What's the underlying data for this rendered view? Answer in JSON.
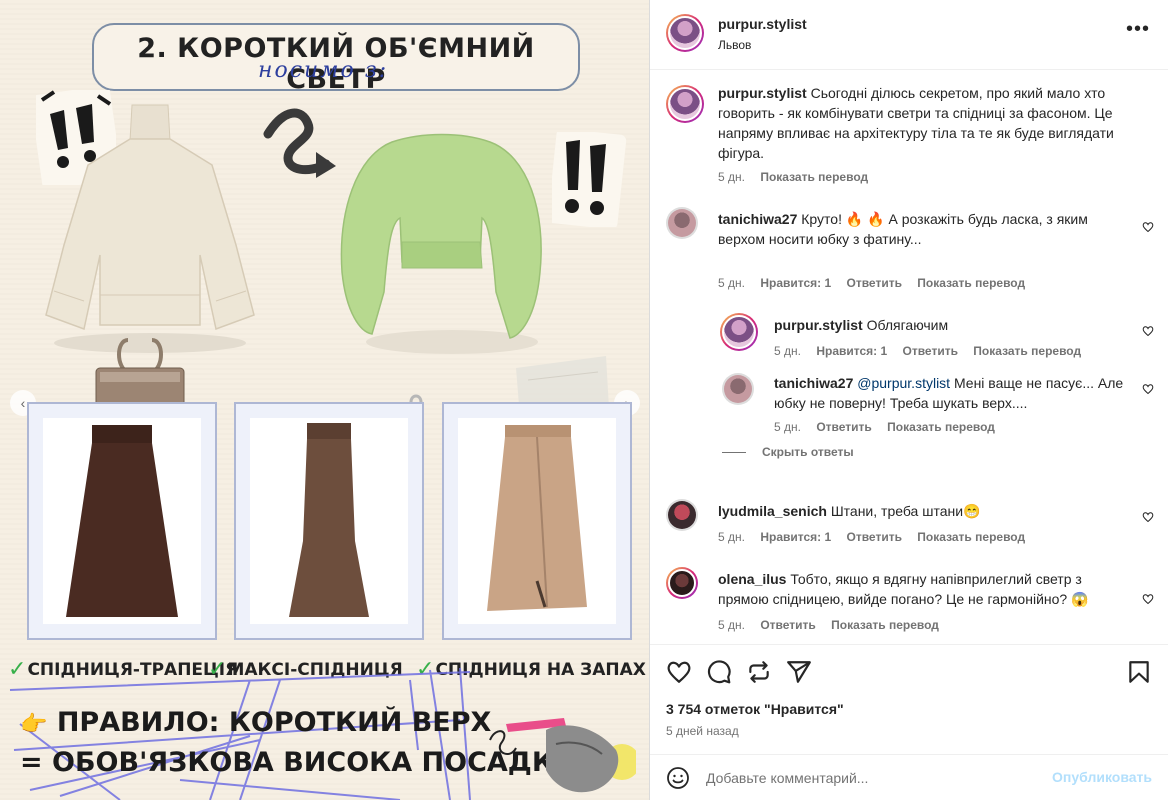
{
  "media": {
    "title": "2. КОРОТКИЙ ОБ'ЄМНИЙ СВЕТР",
    "subtitle": "носимо з:",
    "labels": [
      {
        "text": "СПІДНИЦЯ-ТРАПЕЦІЯ"
      },
      {
        "text": "МАКСІ-СПІДНИЦЯ"
      },
      {
        "text": "СПІДНИЦЯ НА ЗАПАХ"
      }
    ],
    "rule_line1": "ПРАВИЛО: КОРОТКИЙ ВЕРХ",
    "rule_line2": "= ОБОВ'ЯЗКОВА ВИСОКА ПОСАДКА",
    "hand_emoji": "👉",
    "check": "✓",
    "colors": {
      "background": "#f6efe3",
      "title_border": "#7d8ea6",
      "subtitle": "#2d3f9e",
      "check": "#38b04a",
      "scribble": "#6f6fe0",
      "sweater_cream": "#ede6d6",
      "sweater_green": "#b7d98f",
      "skirt_brown": "#4a2b22",
      "skirt_taupe": "#6d4e3d",
      "skirt_camel": "#c9a486"
    }
  },
  "post": {
    "username": "purpur.stylist",
    "location": "Львов",
    "more": "•••",
    "caption": {
      "username": "purpur.stylist",
      "text": "Сьогодні ділюсь секретом, про який мало хто говорить - як комбінувати светри та спідниці за фасоном. Це напряму впливає на архітектуру тіла та те як буде виглядати фігура.",
      "time": "5 дн.",
      "translate": "Показать перевод"
    },
    "comments": [
      {
        "username": "tanichiwa27",
        "text": "Круто! 🔥 🔥 А розкажіть будь ласка, з яким верхом носити юбку з фатину...",
        "time": "5 дн.",
        "likes": "Нравится: 1",
        "reply": "Ответить",
        "translate": "Показать перевод"
      },
      {
        "username": "purpur.stylist",
        "text": "Облягаючим",
        "time": "5 дн.",
        "likes": "Нравится: 1",
        "reply": "Ответить",
        "translate": "Показать перевод"
      },
      {
        "username": "tanichiwa27",
        "mention": "@purpur.stylist",
        "text": " Мені ваще не пасує... Але юбку не поверну! Треба шукать верх....",
        "time": "5 дн.",
        "reply": "Ответить",
        "translate": "Показать перевод"
      },
      {
        "username": "lyudmila_senich",
        "text": "Штани, треба штани😁",
        "time": "5 дн.",
        "likes": "Нравится: 1",
        "reply": "Ответить",
        "translate": "Показать перевод"
      },
      {
        "username": "olena_ilus",
        "text": "Тобто, якщо я вдягну напівприлеглий светр з прямою спідницею, вийде погано? Це не гармонійно? 😱",
        "time": "5 дн.",
        "reply": "Ответить",
        "translate": "Показать перевод"
      }
    ],
    "hide_replies": "Скрыть ответы",
    "likes_count": "3 754 отметок \"Нравится\"",
    "date": "5 дней назад",
    "add_comment_placeholder": "Добавьте комментарий...",
    "publish": "Опубликовать",
    "icons": [
      "heart-icon",
      "comment-icon",
      "share-icon",
      "send-icon",
      "bookmark-icon",
      "emoji-icon"
    ]
  }
}
